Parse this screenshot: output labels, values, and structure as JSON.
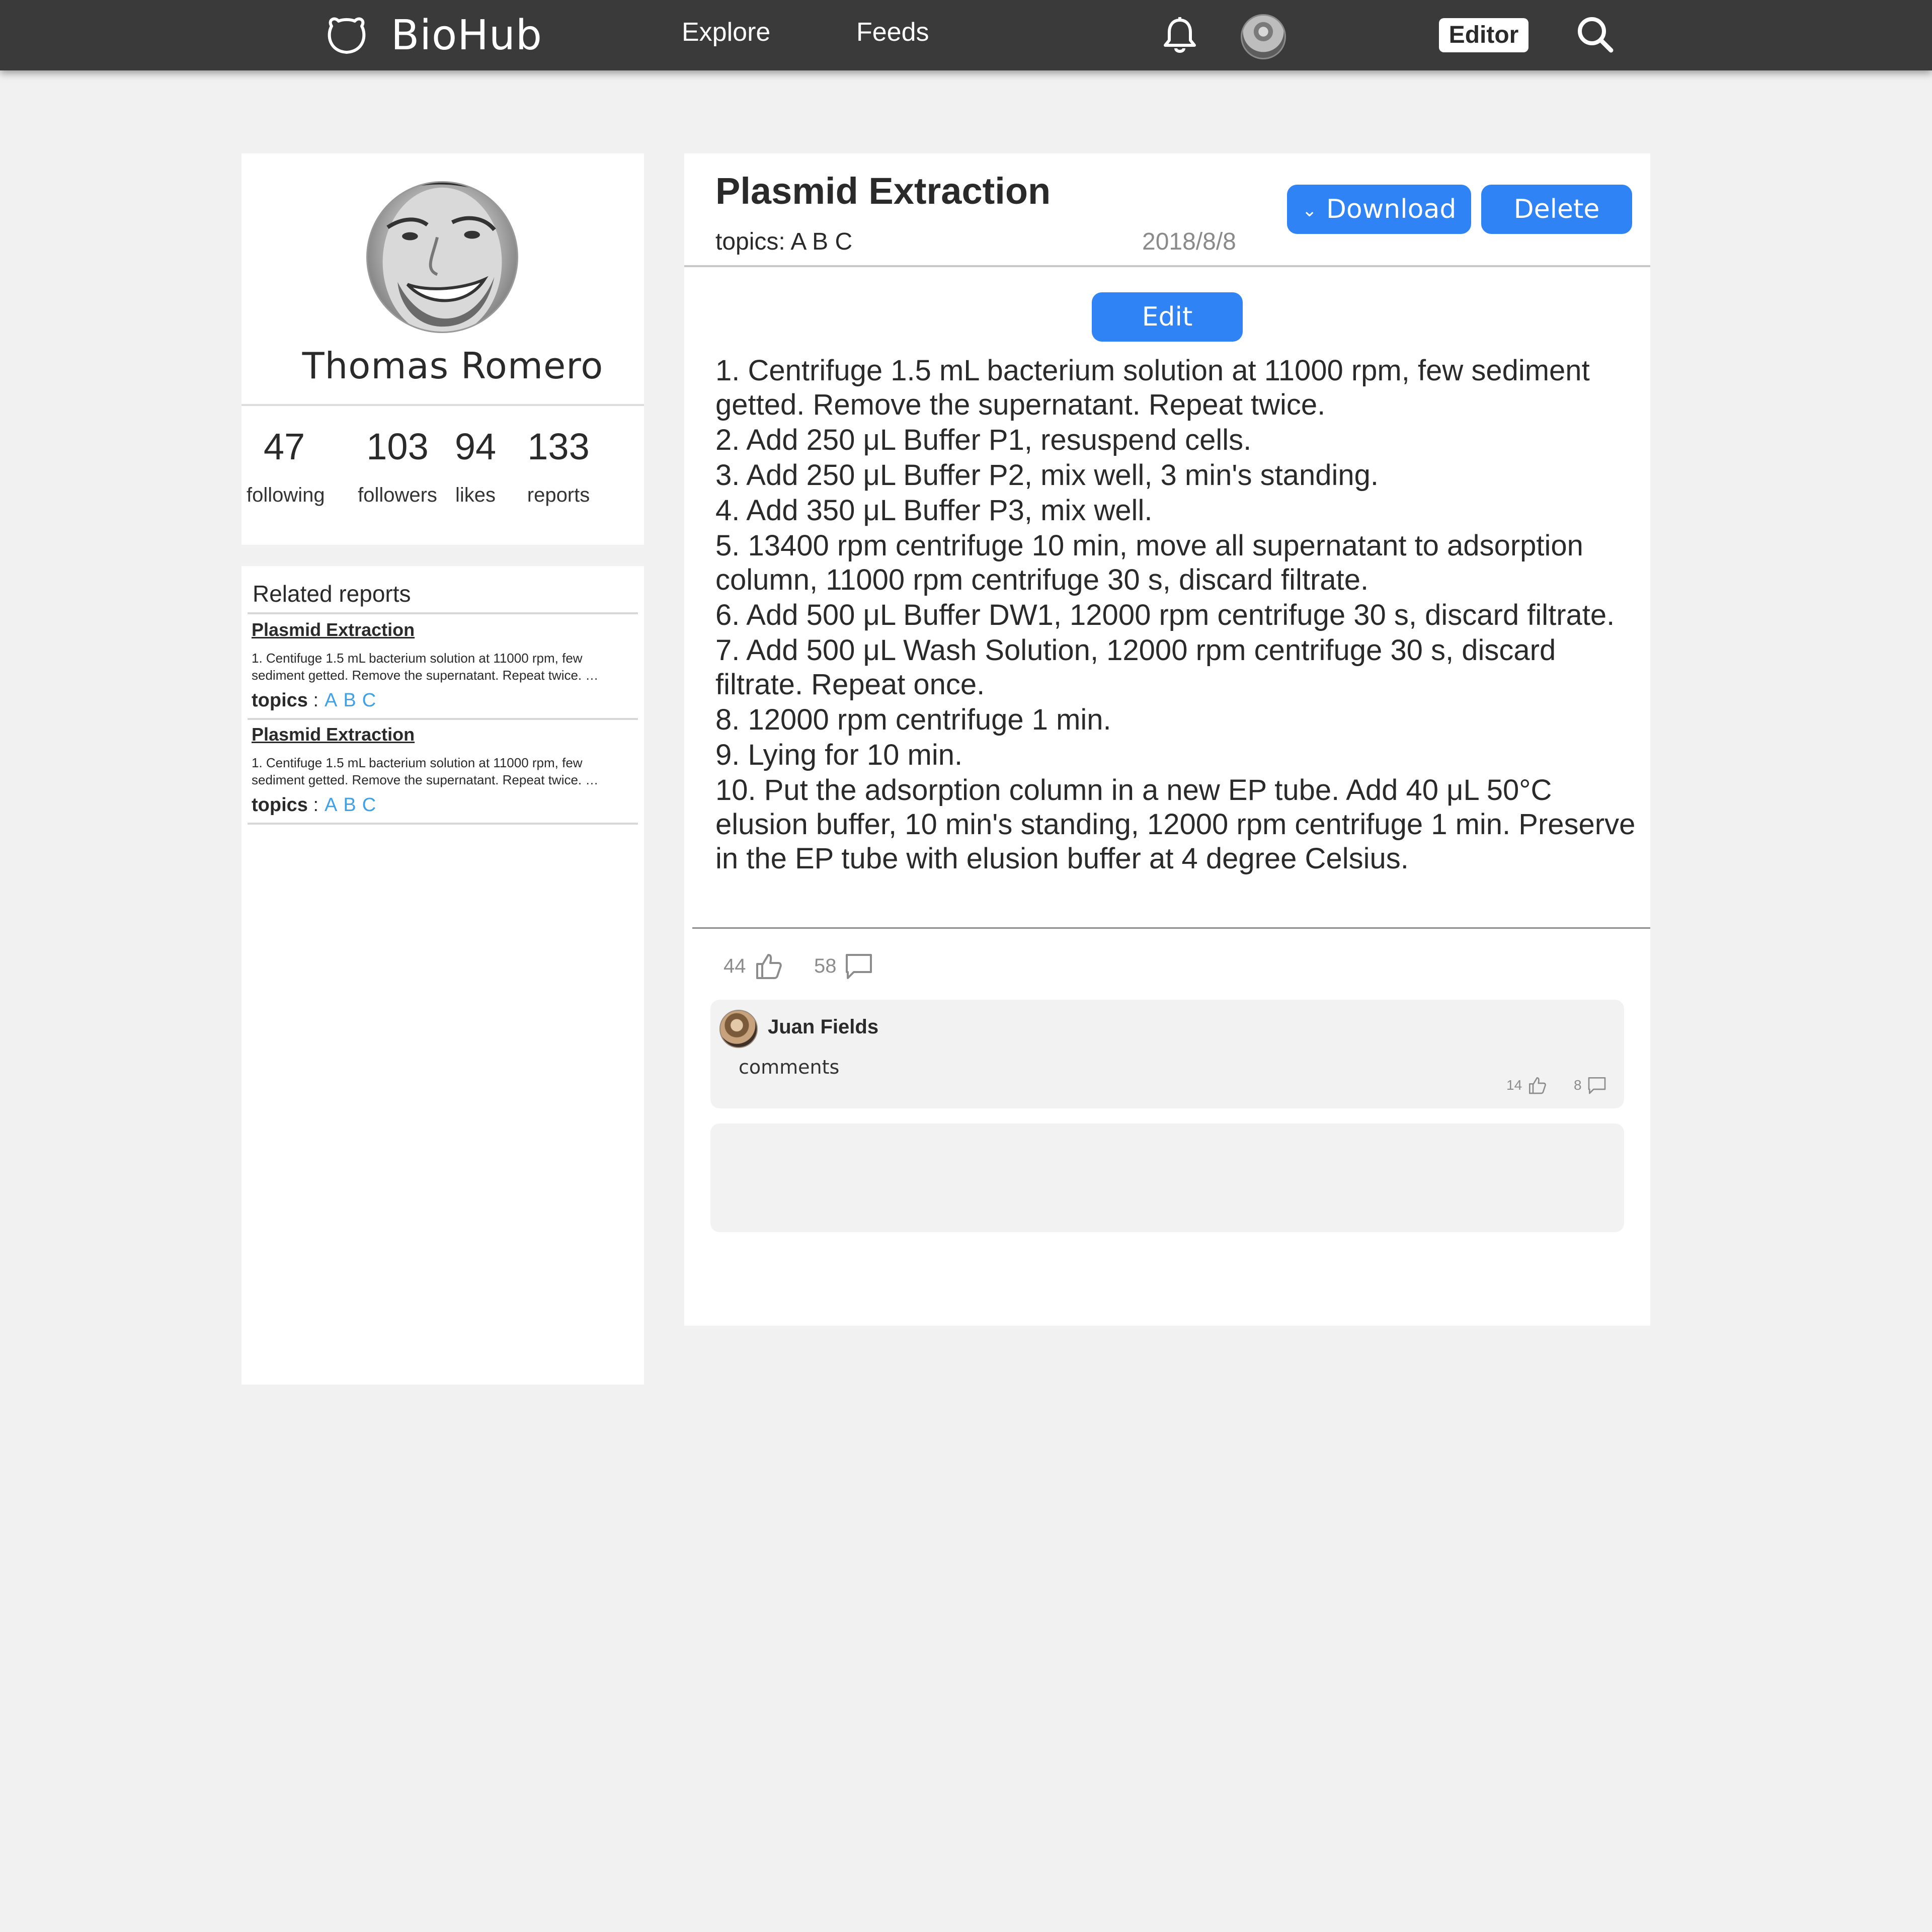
{
  "topbar": {
    "brand": "BioHub",
    "nav": {
      "explore": "Explore",
      "feeds": "Feeds"
    },
    "editor_label": "Editor",
    "icons": {
      "logo": "bear-logo-icon",
      "notifications": "bell-icon",
      "search": "search-icon"
    }
  },
  "profile": {
    "name": "Thomas Romero",
    "stats": {
      "following": {
        "value": "47",
        "label": "following"
      },
      "followers": {
        "value": "103",
        "label": "followers"
      },
      "likes": {
        "value": "94",
        "label": "likes"
      },
      "reports": {
        "value": "133",
        "label": "reports"
      }
    }
  },
  "related": {
    "title": "Related reports",
    "items": [
      {
        "title": "Plasmid Extraction",
        "snippet": "1. Centifuge 1.5 mL bacterium solution at 11000 rpm, few sediment getted. Remove the supernatant. Repeat twice. …",
        "topics_label": "topics",
        "topics": [
          "A",
          "B",
          "C"
        ]
      },
      {
        "title": "Plasmid Extraction",
        "snippet": "1. Centifuge 1.5 mL bacterium solution at 11000 rpm, few sediment getted. Remove the supernatant. Repeat twice. …",
        "topics_label": "topics",
        "topics": [
          "A",
          "B",
          "C"
        ]
      }
    ]
  },
  "article": {
    "title": "Plasmid Extraction",
    "topics": "topics: A B C",
    "date": "2018/8/8",
    "download_label": "Download",
    "delete_label": "Delete",
    "edit_label": "Edit",
    "steps": [
      "1. Centrifuge 1.5 mL bacterium solution at 11000 rpm, few sediment getted. Remove the supernatant. Repeat twice.",
      "2. Add 250 μL Buffer P1, resuspend cells.",
      "3. Add 250 μL Buffer P2, mix well, 3 min's standing.",
      "4. Add 350 μL Buffer P3, mix well.",
      "5. 13400 rpm centrifuge 10 min, move all supernatant to adsorption column, 11000 rpm centrifuge 30 s, discard filtrate.",
      "6. Add 500 μL Buffer DW1, 12000 rpm centrifuge 30 s, discard filtrate.",
      "7. Add 500 μL Wash Solution, 12000 rpm centrifuge 30 s, discard filtrate. Repeat once.",
      "8. 12000 rpm centrifuge 1 min.",
      "9. Lying for 10 min.",
      "10. Put the adsorption column in a new EP tube. Add 40 μL 50°C elusion buffer, 10 min's standing, 12000 rpm centrifuge 1 min. Preserve in the EP tube with elusion buffer at 4 degree Celsius."
    ],
    "likes": "44",
    "comments_count": "58"
  },
  "comments": [
    {
      "author": "Juan Fields",
      "text": "comments",
      "likes": "14",
      "replies": "8"
    }
  ],
  "colors": {
    "topbar": "#3a3a3a",
    "accent": "#2f83f5",
    "link": "#3ea0e6",
    "page_bg": "#f1f1f1"
  }
}
